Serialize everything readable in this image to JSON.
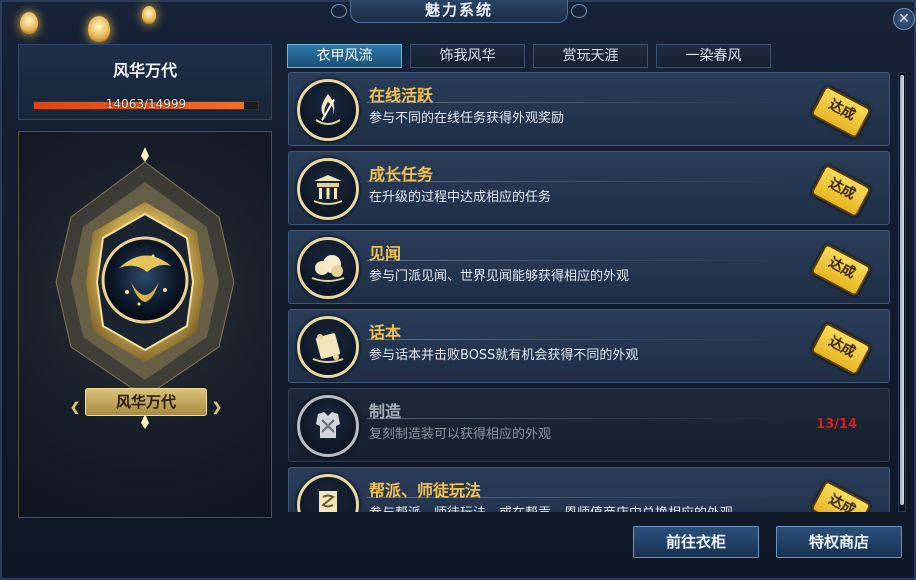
{
  "window": {
    "title": "魅力系统",
    "close_label": "✕"
  },
  "left_panel": {
    "title": "风华万代",
    "progress_text": "14063/14999",
    "progress_fraction": 0.9376,
    "emblem_label": "风华万代"
  },
  "tabs": [
    {
      "label": "衣甲风流",
      "active": true
    },
    {
      "label": "饰我风华",
      "active": false
    },
    {
      "label": "赏玩天涯",
      "active": false
    },
    {
      "label": "一染春风",
      "active": false
    }
  ],
  "tasks": [
    {
      "title": "在线活跃",
      "desc": "参与不同的在线任务获得外观奖励",
      "status": "达成",
      "icon": "flame-sword-icon"
    },
    {
      "title": "成长任务",
      "desc": "在升级的过程中达成相应的任务",
      "status": "达成",
      "icon": "pavilion-icon"
    },
    {
      "title": "见闻",
      "desc": "参与门派见闻、世界见闻能够获得相应的外观",
      "status": "达成",
      "icon": "cloud-icon"
    },
    {
      "title": "话本",
      "desc": "参与话本并击败BOSS就有机会获得不同的外观",
      "status": "达成",
      "icon": "scroll-icon"
    },
    {
      "title": "制造",
      "desc": "复刻制造装可以获得相应的外观",
      "progress": "13/14",
      "icon": "armor-icon"
    },
    {
      "title": "帮派、师徒玩法",
      "desc": "参与帮派、师徒玩法，或在帮贡、恩师值商店中兑换相应的外观",
      "status": "达成",
      "icon": "banner-icon"
    }
  ],
  "buttons": {
    "wardrobe": "前往衣柜",
    "privilege_shop": "特权商店"
  }
}
